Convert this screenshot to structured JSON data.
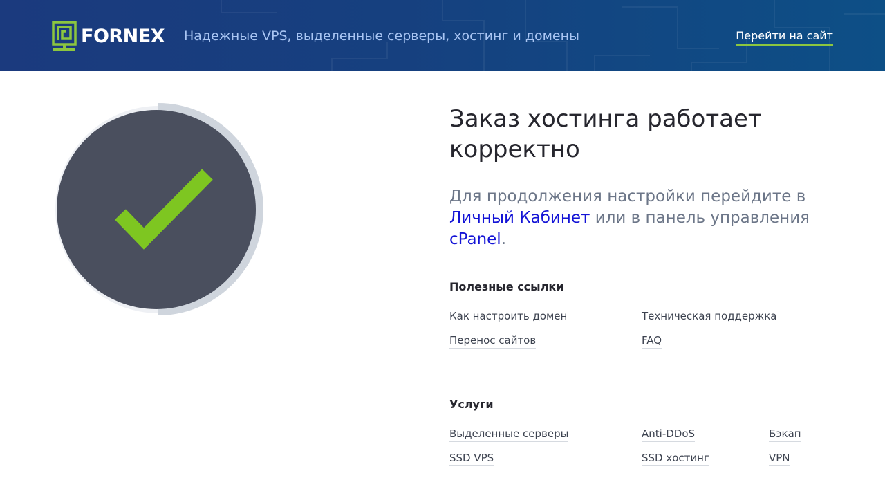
{
  "header": {
    "logo_text": "FORNEX",
    "tagline": "Надежные VPS, выделенные серверы, хостинг и домены",
    "site_link": "Перейти на сайт"
  },
  "status": {
    "icon": "checkmark-icon",
    "check_color": "#7ec621",
    "circle_color": "#4a4f5e",
    "ring_color": "#cfd5dd"
  },
  "main": {
    "title": "Заказ хостинга работает корректно",
    "lead_part1": "Для продолжения настройки перейдите в ",
    "lead_link1": "Личный Кабинет",
    "lead_part2": " или в панель управления ",
    "lead_link2": "cPanel",
    "lead_part3": "."
  },
  "useful_links": {
    "title": "Полезные ссылки",
    "items": [
      "Как настроить домен",
      "Техническая поддержка",
      "Перенос сайтов",
      "FAQ"
    ]
  },
  "services": {
    "title": "Услуги",
    "items": [
      "Выделенные серверы",
      "Anti-DDoS",
      "Бэкап",
      "SSD VPS",
      "SSD хостинг",
      "VPN"
    ]
  },
  "colors": {
    "header_bg": "#1b3a7e",
    "accent": "#8cc63f",
    "link": "#1414d6"
  }
}
